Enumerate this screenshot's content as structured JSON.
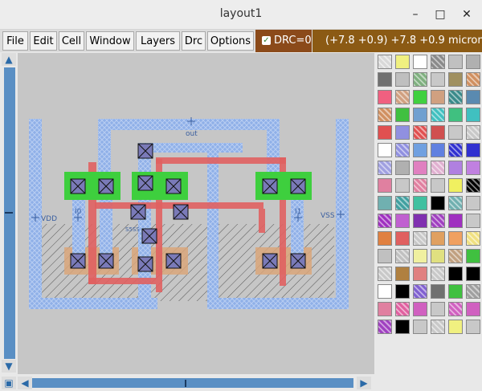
{
  "window": {
    "title": "layout1",
    "minimize": "–",
    "maximize": "□",
    "close": "✕"
  },
  "menu": {
    "file": "File",
    "edit": "Edit",
    "cell": "Cell",
    "window": "Window",
    "layers": "Layers",
    "drc": "Drc",
    "options": "Options"
  },
  "status": {
    "drc_label": "DRC=0",
    "drc_checked": true,
    "coords": "(+7.8 +0.9) +7.8 +0.9 microns"
  },
  "layout": {
    "labels": {
      "out": "out",
      "vdd": "VDD",
      "vss": "VSS",
      "i0": "I0",
      "i1": "I1",
      "small": "S5SS"
    }
  },
  "colors": {
    "metal1": "#8fb0e8",
    "poly": "#e06060",
    "active": "#3ecf3e",
    "contact": "#7070b0",
    "nwell_hatch": "#444444",
    "diffusion": "#d9a67a",
    "drc_bg": "#8b4a1a",
    "coords_bg": "#8b5a14"
  },
  "palette": {
    "swatches": [
      "#d8d8d8",
      "#f0f080",
      "#ffffff",
      "#8a8a8a",
      "#c0c0c0",
      "#b0b0b0",
      "#707070",
      "#bfbfbf",
      "#7fb07f",
      "#c8c8c8",
      "#a09060",
      "#d09060",
      "#f06080",
      "#d0a080",
      "#40d040",
      "#d0a080",
      "#3a8a8a",
      "#5a8ab0",
      "#d09060",
      "#40c040",
      "#70a0d0",
      "#40c0c0",
      "#40c080",
      "#40c0c0",
      "#e05050",
      "#9090e0",
      "#e05050",
      "#d05050",
      "#c8c8c8",
      "#c8c8c8",
      "#ffffff",
      "#9090e0",
      "#70a0e0",
      "#6080e0",
      "#3030d0",
      "#3030d0",
      "#a0a0e0",
      "#b0b0b0",
      "#e080c0",
      "#e0b0d0",
      "#b080e0",
      "#c080e0",
      "#e080a0",
      "#c8c8c8",
      "#e080a0",
      "#c8c8c8",
      "#f0f060",
      "#000000",
      "#70b0b0",
      "#40a0a0",
      "#40c0a0",
      "#000000",
      "#70b0b0",
      "#c8c8c8",
      "#a030c0",
      "#c060d0",
      "#8030b0",
      "#a040c0",
      "#a030c0",
      "#c8c8c8",
      "#e08040",
      "#e06060",
      "#c8c8c8",
      "#e0a060",
      "#f0a060",
      "#f0e080",
      "#c0c0c0",
      "#c0c0c0",
      "#f0f0a0",
      "#e0e080",
      "#c0a080",
      "#40c040",
      "#c8c8c8",
      "#b08040",
      "#e08080",
      "#c8c8c8",
      "#000000",
      "#000000",
      "#ffffff",
      "#000000",
      "#8060d0",
      "#707070",
      "#40c040",
      "#a0a0a0",
      "#e080a0",
      "#e060a0",
      "#d060c0",
      "#c8c8c8",
      "#d060c0",
      "#d060c0",
      "#a040c0",
      "#000000",
      "#c8c8c8",
      "#c8c8c8",
      "#f0f080",
      "#c8c8c8"
    ]
  }
}
